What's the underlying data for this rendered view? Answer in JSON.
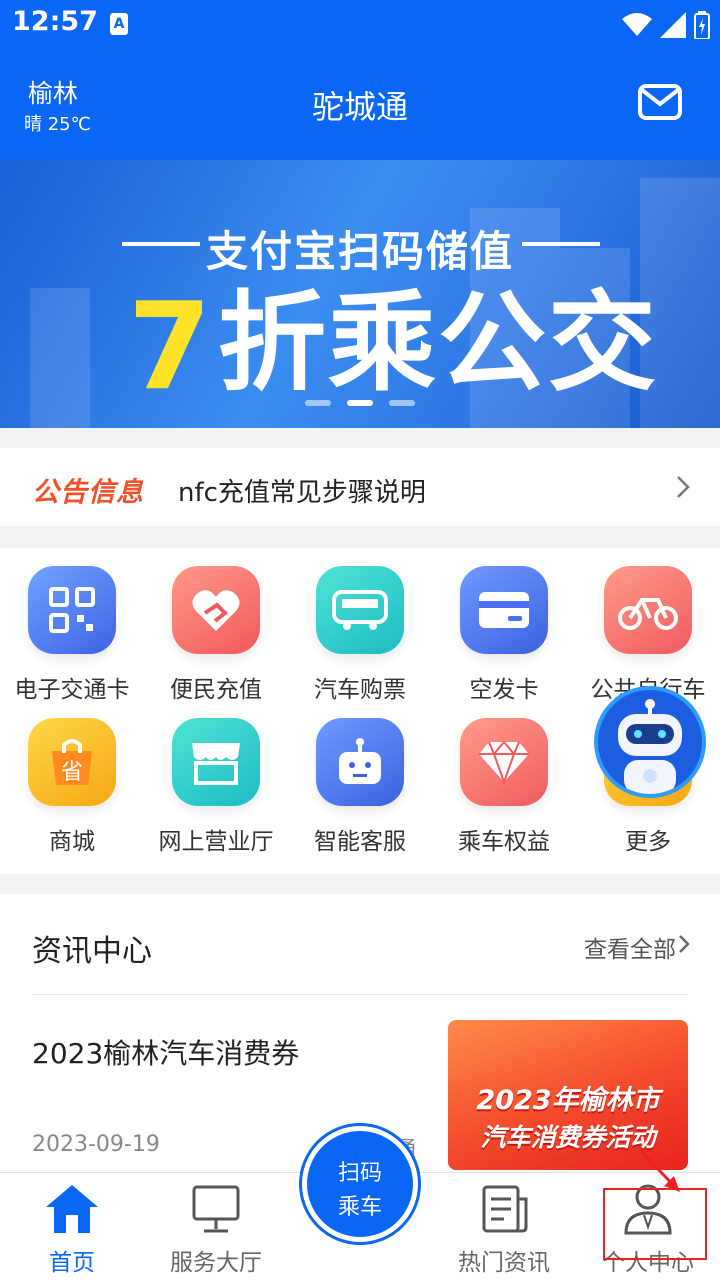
{
  "status_bar": {
    "time": "12:57",
    "badge": "A"
  },
  "header": {
    "city": "榆林",
    "weather": "晴 25℃",
    "title": "驼城通"
  },
  "banner": {
    "line1": "支付宝扫码储值",
    "seven": "7",
    "discount": "折乘公交"
  },
  "notice": {
    "tag": "公告信息",
    "text": "nfc充值常见步骤说明"
  },
  "services": [
    {
      "label": "电子交通卡",
      "icon": "qr-card-icon"
    },
    {
      "label": "便民充值",
      "icon": "heart-hand-icon"
    },
    {
      "label": "汽车购票",
      "icon": "bus-icon"
    },
    {
      "label": "空发卡",
      "icon": "card-icon"
    },
    {
      "label": "公共自行车",
      "icon": "bicycle-icon"
    },
    {
      "label": "商城",
      "icon": "shopping-bag-icon"
    },
    {
      "label": "网上营业厅",
      "icon": "store-icon"
    },
    {
      "label": "智能客服",
      "icon": "robot-icon"
    },
    {
      "label": "乘车权益",
      "icon": "diamond-icon"
    },
    {
      "label": "更多",
      "icon": "more-icon"
    }
  ],
  "news": {
    "header": "资讯中心",
    "view_all": "查看全部",
    "item": {
      "title": "2023榆林汽车消费券",
      "date": "2023-09-19",
      "source_fragment": "通",
      "thumb_line1": "2023年榆林市",
      "thumb_line2": "汽车消费券活动"
    }
  },
  "tabbar": {
    "home": "首页",
    "service_hall": "服务大厅",
    "scan_line1": "扫码",
    "scan_line2": "乘车",
    "hot_news": "热门资讯",
    "profile": "个人中心"
  },
  "colors": {
    "brand": "#0a66f5",
    "notice": "#f0522a"
  }
}
